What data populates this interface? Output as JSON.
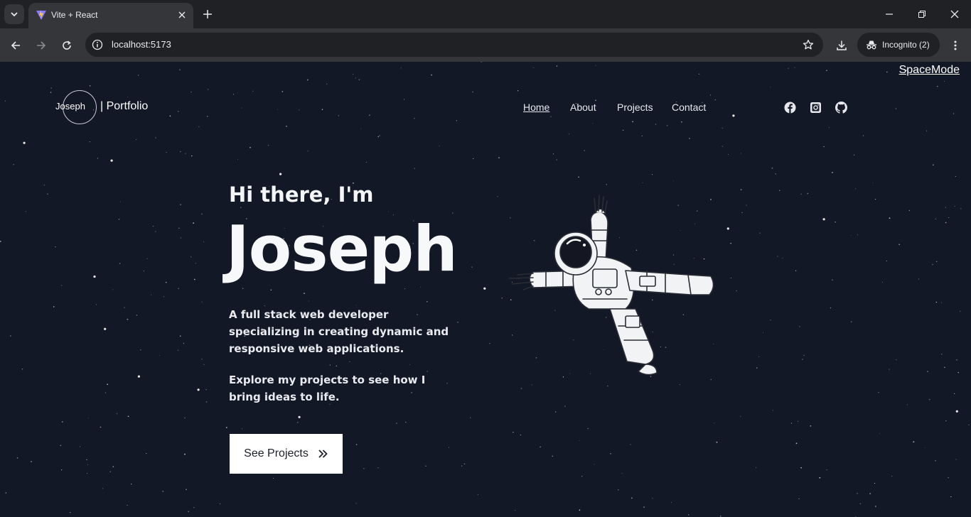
{
  "browser": {
    "tab_title": "Vite + React",
    "url": "localhost:5173",
    "incognito_label": "Incognito (2)"
  },
  "page": {
    "spacemode_label": "SpaceMode",
    "logo": {
      "name": "Joseph",
      "suffix": "| Portfolio"
    },
    "nav": [
      {
        "label": "Home",
        "active": true
      },
      {
        "label": "About",
        "active": false
      },
      {
        "label": "Projects",
        "active": false
      },
      {
        "label": "Contact",
        "active": false
      }
    ],
    "social_icons": [
      "facebook-icon",
      "instagram-icon",
      "github-icon"
    ],
    "hero": {
      "greeting": "Hi there, I'm",
      "name": "Joseph",
      "description": "A full stack web developer specializing in creating dynamic and responsive web applications.",
      "tagline": "Explore my projects to see how I bring ideas to life.",
      "cta_label": "See Projects",
      "cta_icon": "double-chevron-right-icon"
    },
    "illustration": "astronaut-icon"
  },
  "colors": {
    "background": "#131826",
    "chrome_dark": "#202124",
    "chrome_light": "#35363a",
    "cta_background": "#ffffff"
  }
}
